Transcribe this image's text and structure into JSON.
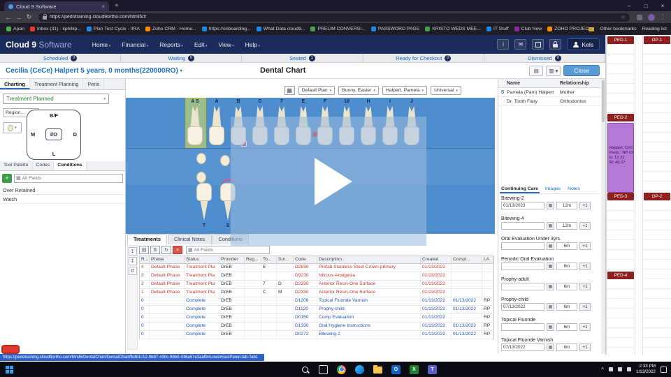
{
  "browser": {
    "tab_title": "Cloud 9 Software",
    "url": "https://pedotraining.cloud9ortho.com/html5/#",
    "bookmarks": [
      {
        "label": "Apan",
        "color": "#4caf50"
      },
      {
        "label": "Inbox (31) - kphillip...",
        "color": "#e53935"
      },
      {
        "label": "Plan Test Cycle - IIRA",
        "color": "#1e88e5"
      },
      {
        "label": "Zoho CRM - Home...",
        "color": "#fb8c00"
      },
      {
        "label": "https://onboarding...",
        "color": "#1e88e5"
      },
      {
        "label": "What Data cloud9...",
        "color": "#1e88e5"
      },
      {
        "label": "PRELIM CONVERSI...",
        "color": "#43a047"
      },
      {
        "label": "PASSWORD PAGE",
        "color": "#1e88e5"
      },
      {
        "label": "KRISTO WEDS MEE...",
        "color": "#43a047"
      },
      {
        "label": "IT Stuff",
        "color": "#1e88e5"
      },
      {
        "label": "Club New",
        "color": "#8e24aa"
      },
      {
        "label": "ZOHO PROJECTS",
        "color": "#fb8c00"
      }
    ],
    "other_bookmarks": "Other bookmarks",
    "reading_list": "Reading list"
  },
  "app": {
    "brand_bold": "Cloud 9",
    "brand_light": "Software",
    "menus": [
      "Home",
      "Financial",
      "Reports",
      "Edit",
      "View",
      "Help"
    ],
    "user_button": "Kels"
  },
  "status_tabs": [
    {
      "label": "Scheduled",
      "count": "0"
    },
    {
      "label": "Waiting",
      "count": "0"
    },
    {
      "label": "Seated",
      "count": "1"
    },
    {
      "label": "Ready for Checkout",
      "count": "0"
    },
    {
      "label": "Dismissed",
      "count": "0"
    }
  ],
  "patient": {
    "name": "Cecilia (CeCe) Halpert 5 years, 0 months(220000RO)",
    "page_title": "Dental Chart",
    "close_label": "Close"
  },
  "chart_tabs": [
    "Charting",
    "Treatment Planning",
    "Perio"
  ],
  "left_panel": {
    "filter_value": "Treatment Planned",
    "region_label": "Region...",
    "surfaces": {
      "top": "B/F",
      "left": "M",
      "center": "I/O",
      "right": "D",
      "bottom": "L"
    },
    "tabs": [
      "Tool Palette",
      "Codes",
      "Conditions"
    ],
    "search_placeholder": "All Fields",
    "items": [
      "Over Retained",
      "Watch"
    ]
  },
  "chart_toolbar": {
    "selects": [
      "Default Plan",
      "Bunny, Easter",
      "Halpert, Pamela",
      "Universal"
    ]
  },
  "dental_chart": {
    "upper_teeth": [
      "A S",
      "A",
      "B",
      "C",
      "7",
      "E",
      "F",
      "10",
      "H",
      "I",
      "J"
    ],
    "lower_teeth": [
      "T",
      "S"
    ]
  },
  "treatments": {
    "tabs": [
      "Treatments",
      "Clinical Notes",
      "Conditions"
    ],
    "search_placeholder": "All Fields",
    "columns": [
      "R...",
      "Phase",
      "Status",
      "Provider",
      "Reg...",
      "To...",
      "Sur...",
      "Code",
      "Description",
      "Created",
      "Compl...",
      "LA"
    ],
    "rows": [
      {
        "r": "4",
        "phase": "Default Phase",
        "status": "Treatment Pla",
        "provider": "DrEB",
        "reg": "",
        "to": "E",
        "sur": "",
        "code": "D2930",
        "desc": "Prefab Stainless Steel Crown-primary",
        "created": "01/13/2022",
        "compl": "",
        "la": "",
        "planned": true
      },
      {
        "r": "3",
        "phase": "Default Phase",
        "status": "Treatment Pla",
        "provider": "DrEB",
        "reg": "",
        "to": "",
        "sur": "",
        "code": "D9230",
        "desc": "Nitrous-Analgesia",
        "created": "01/13/2022",
        "compl": "",
        "la": "",
        "planned": true
      },
      {
        "r": "2",
        "phase": "Default Phase",
        "status": "Treatment Pla",
        "provider": "DrEB",
        "reg": "",
        "to": "7",
        "sur": "D",
        "code": "D2330",
        "desc": "Anterior Resin-One Surface",
        "created": "01/13/2022",
        "compl": "",
        "la": "",
        "planned": true
      },
      {
        "r": "1",
        "phase": "Default Phase",
        "status": "Treatment Pla",
        "provider": "DrEB",
        "reg": "",
        "to": "C",
        "sur": "M",
        "code": "D2330",
        "desc": "Anterior Resin-One Surface",
        "created": "01/13/2022",
        "compl": "",
        "la": "",
        "planned": true
      },
      {
        "r": "0",
        "phase": "",
        "status": "Complete",
        "provider": "DrEB",
        "reg": "",
        "to": "",
        "sur": "",
        "code": "D1206",
        "desc": "Topical Fluoride Varnish",
        "created": "01/13/2022",
        "compl": "01/13/2022",
        "la": "RP",
        "planned": false
      },
      {
        "r": "0",
        "phase": "",
        "status": "Complete",
        "provider": "DrEB",
        "reg": "",
        "to": "",
        "sur": "",
        "code": "D1120",
        "desc": "Prophy-child",
        "created": "01/13/2022",
        "compl": "01/13/2022",
        "la": "RP",
        "planned": false
      },
      {
        "r": "0",
        "phase": "",
        "status": "Complete",
        "provider": "DrEB",
        "reg": "",
        "to": "",
        "sur": "",
        "code": "D0150",
        "desc": "Comp Evaluation",
        "created": "01/13/2022",
        "compl": "",
        "la": "RP",
        "planned": false
      },
      {
        "r": "0",
        "phase": "",
        "status": "Complete",
        "provider": "DrEB",
        "reg": "",
        "to": "",
        "sur": "",
        "code": "D1330",
        "desc": "Oral Hygiene Instructions",
        "created": "01/13/2022",
        "compl": "01/13/2022",
        "la": "RP",
        "planned": false
      },
      {
        "r": "0",
        "phase": "",
        "status": "Complete",
        "provider": "DrEB",
        "reg": "",
        "to": "",
        "sur": "",
        "code": "D0272",
        "desc": "Bitewing-2",
        "created": "01/13/2022",
        "compl": "01/13/2022",
        "la": "RP",
        "planned": false
      }
    ]
  },
  "contacts": {
    "columns": [
      "Name",
      "Relationship"
    ],
    "rows": [
      {
        "marker": "S",
        "name": "Pamela (Pam) Halpert",
        "relationship": "Mother"
      },
      {
        "marker": "",
        "name": "Dr. Tooth Fairy",
        "relationship": "Orthodontist"
      }
    ]
  },
  "continuing_care": {
    "tabs": [
      "Continuing Care",
      "Images",
      "Notes"
    ],
    "plus_label": "+1",
    "items": [
      {
        "name": "Bitewing-2",
        "date": "01/13/2023",
        "interval": "12m"
      },
      {
        "name": "Bitewing-4",
        "date": "",
        "interval": "12m"
      },
      {
        "name": "Oral Evaluation Under 3yrs.",
        "date": "",
        "interval": "6m"
      },
      {
        "name": "Periodic Oral Evaluation",
        "date": "",
        "interval": "6m"
      },
      {
        "name": "Prophy-adult",
        "date": "",
        "interval": "6m"
      },
      {
        "name": "Prophy-child",
        "date": "07/13/2022",
        "interval": "6m"
      },
      {
        "name": "Topical Fluoride",
        "date": "",
        "interval": "6m"
      },
      {
        "name": "Topical Fluoride Varnish",
        "date": "07/13/2022",
        "interval": "6m"
      }
    ]
  },
  "schedule": {
    "headers": [
      {
        "label": "PED-1",
        "col": 0,
        "slot": 0
      },
      {
        "label": "OP-1",
        "col": 1,
        "slot": 0
      },
      {
        "label": "PED-2",
        "col": 0,
        "slot": 1
      },
      {
        "label": "PED-3",
        "col": 0,
        "slot": 2
      },
      {
        "label": "OP-2",
        "col": 1,
        "slot": 2
      },
      {
        "label": "PED-4",
        "col": 0,
        "slot": 3
      }
    ],
    "appointment": {
      "lines": [
        "Halpert, CeC",
        "Pedo : NP Chi",
        "E: 13.22",
        "M: 40.37"
      ]
    }
  },
  "status_link": "https://pedotraining.cloud9ortho.com/html5/DentalChart/DentalChart/fkdb1c12-9b97-430c-98b0-036a57e2aaf9#LowerEastPanel-tab-Tab1",
  "taskbar": {
    "time": "2:33 PM",
    "date": "1/13/2022",
    "icons": [
      {
        "name": "search"
      },
      {
        "name": "task-view"
      },
      {
        "name": "chrome"
      },
      {
        "name": "edge"
      },
      {
        "name": "folder"
      },
      {
        "name": "outlook",
        "letter": "O",
        "color": "#1565c0"
      },
      {
        "name": "excel",
        "letter": "X",
        "color": "#1e7e34"
      },
      {
        "name": "teams",
        "letter": "T",
        "color": "#5b5fc7"
      }
    ]
  }
}
